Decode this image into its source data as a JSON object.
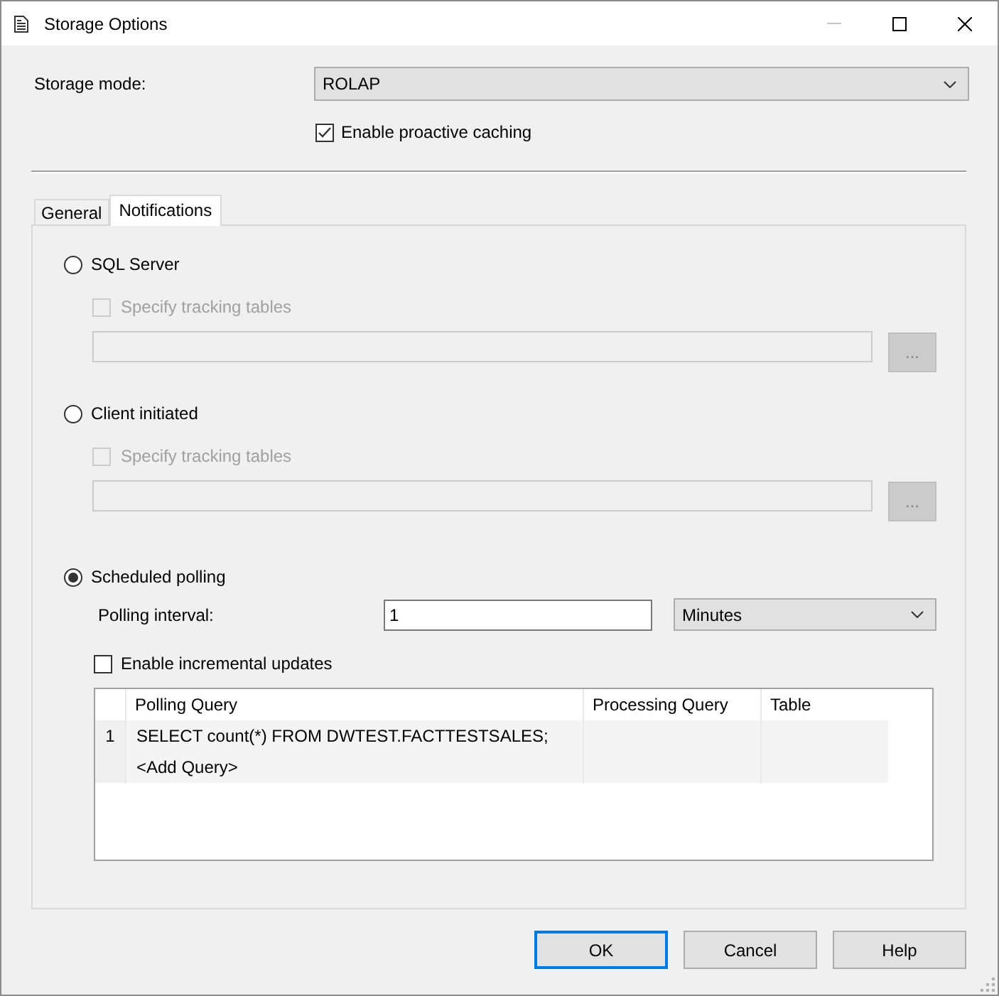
{
  "window": {
    "title": "Storage Options",
    "controls": [
      {
        "kind": "minimize",
        "disabled": true
      },
      {
        "kind": "maximize",
        "disabled": false
      },
      {
        "kind": "close",
        "disabled": false
      }
    ]
  },
  "storage_mode": {
    "label": "Storage mode:",
    "value": "ROLAP"
  },
  "proactive_caching": {
    "label": "Enable proactive caching",
    "checked": true
  },
  "tabs": [
    {
      "label": "General",
      "selected": false
    },
    {
      "label": "Notifications",
      "selected": true
    }
  ],
  "notification_options": [
    {
      "kind": "tracking",
      "label": "SQL Server",
      "selected": false,
      "tracking_tables": {
        "label": "Specify tracking tables",
        "checked": false,
        "disabled": true
      },
      "tables_field": {
        "disabled": true
      },
      "browse_button": {
        "label": "...",
        "disabled": true
      }
    },
    {
      "kind": "tracking",
      "label": "Client initiated",
      "selected": false,
      "tracking_tables": {
        "label": "Specify tracking tables",
        "checked": false,
        "disabled": true
      },
      "tables_field": {
        "disabled": true
      },
      "browse_button": {
        "label": "...",
        "disabled": true
      }
    },
    {
      "kind": "polling",
      "label": "Scheduled polling",
      "selected": true,
      "polling_interval": {
        "label": "Polling interval:",
        "value": "1",
        "unit": "Minutes"
      },
      "incremental_updates": {
        "label": "Enable incremental updates",
        "checked": false
      },
      "query_grid": {
        "columns": [
          "Polling Query",
          "Processing Query",
          "Table"
        ],
        "rows": [
          {
            "number": "1",
            "cells": [
              "SELECT count(*) FROM DWTEST.FACTTESTSALES;"
            ]
          },
          {
            "cells": [
              "<Add Query>"
            ]
          }
        ]
      }
    }
  ],
  "buttons": [
    {
      "label": "OK",
      "focused": true
    },
    {
      "label": "Cancel",
      "focused": false
    },
    {
      "label": "Help",
      "focused": false
    }
  ]
}
